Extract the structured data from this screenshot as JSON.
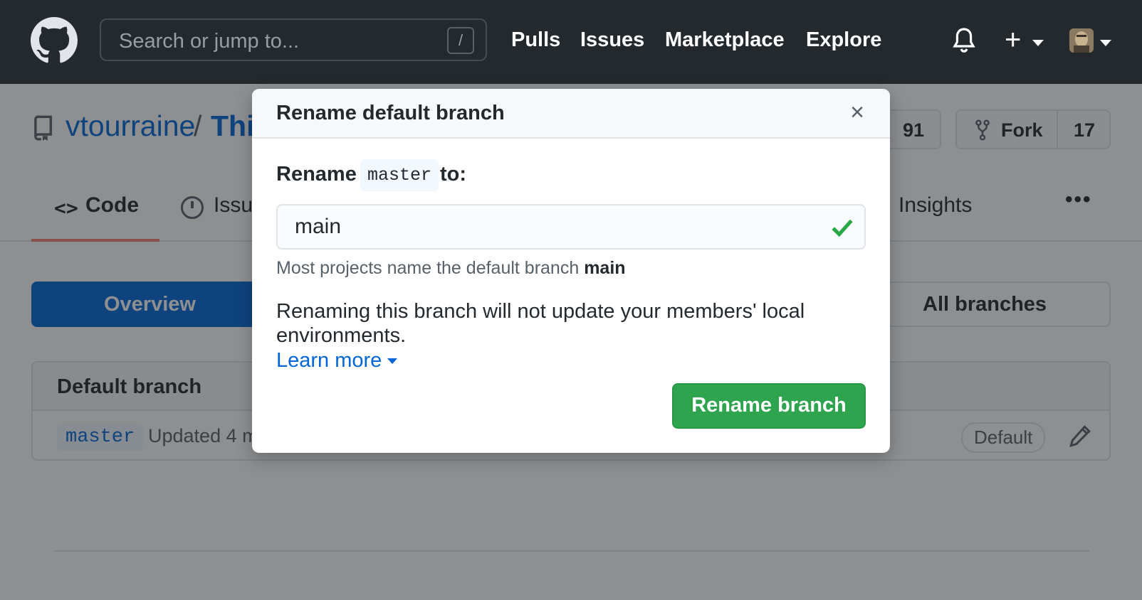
{
  "header": {
    "search_placeholder": "Search or jump to...",
    "search_shortcut": "/",
    "nav": [
      "Pulls",
      "Issues",
      "Marketplace",
      "Explore"
    ],
    "plus": "+"
  },
  "repo": {
    "owner": "vtourraine",
    "separator": "/",
    "name_visible": "Thi",
    "star_count": "91",
    "fork_label": "Fork",
    "fork_count": "17"
  },
  "tabs": {
    "code": "Code",
    "issues_visible": "Issu",
    "insights": "Insights",
    "more": "•••"
  },
  "branches": {
    "overview": "Overview",
    "all_branches": "All branches",
    "default_heading": "Default branch",
    "branch_name": "master",
    "updated_visible": "Updated 4 m",
    "default_badge": "Default"
  },
  "modal": {
    "title": "Rename default branch",
    "close": "×",
    "rename_prefix": "Rename",
    "current_branch": "master",
    "rename_suffix": "to:",
    "input_value": "main",
    "hint_text": "Most projects name the default branch",
    "hint_bold": "main",
    "warning": "Renaming this branch will not update your members' local environments.",
    "learn_more": "Learn more",
    "submit": "Rename branch"
  },
  "colors": {
    "header_bg": "#24292e",
    "link": "#0366d6",
    "primary_button": "#2ea44f",
    "tab_underline": "#f9826c"
  }
}
